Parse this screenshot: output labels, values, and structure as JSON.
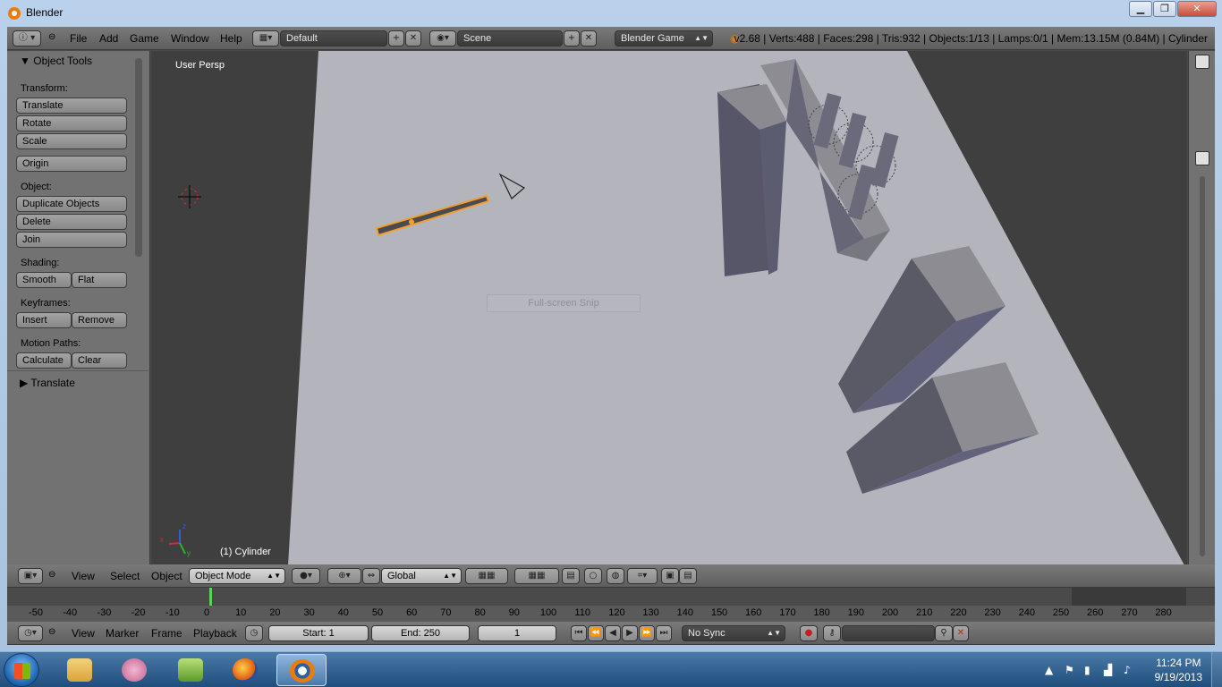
{
  "window": {
    "title": "Blender"
  },
  "top_header": {
    "menus": [
      "File",
      "Add",
      "Game",
      "Window",
      "Help"
    ],
    "screen_layout": "Default",
    "scene": "Scene",
    "engine": "Blender Game",
    "stats": "v2.68 | Verts:488 | Faces:298 | Tris:932 | Objects:1/13 | Lamps:0/1 | Mem:13.15M (0.84M) | Cylinder"
  },
  "tool_panel": {
    "title": "Object Tools",
    "transform_label": "Transform:",
    "translate": "Translate",
    "rotate": "Rotate",
    "scale": "Scale",
    "origin": "Origin",
    "object_label": "Object:",
    "duplicate": "Duplicate Objects",
    "delete": "Delete",
    "join": "Join",
    "shading_label": "Shading:",
    "smooth": "Smooth",
    "flat": "Flat",
    "keyframes_label": "Keyframes:",
    "insert": "Insert",
    "remove": "Remove",
    "motion_label": "Motion Paths:",
    "calculate": "Calculate",
    "clear": "Clear",
    "operator_panel": "Translate"
  },
  "viewport": {
    "view_label": "User Persp",
    "object_label": "(1) Cylinder",
    "snip_text": "Full-screen Snip",
    "axis_x": "x",
    "axis_y": "y",
    "axis_z": "z"
  },
  "view3d_header": {
    "menus": [
      "View",
      "Select",
      "Object"
    ],
    "mode": "Object Mode",
    "orientation": "Global"
  },
  "timeline": {
    "ticks": [
      "-50",
      "-40",
      "-30",
      "-20",
      "-10",
      "0",
      "10",
      "20",
      "30",
      "40",
      "50",
      "60",
      "70",
      "80",
      "90",
      "100",
      "110",
      "120",
      "130",
      "140",
      "150",
      "160",
      "170",
      "180",
      "190",
      "200",
      "210",
      "220",
      "230",
      "240",
      "250",
      "260",
      "270",
      "280"
    ],
    "current_frame_marker": 0
  },
  "timeline_header": {
    "menus": [
      "View",
      "Marker",
      "Frame",
      "Playback"
    ],
    "start": "Start: 1",
    "end": "End: 250",
    "frame": "1",
    "sync": "No Sync"
  },
  "taskbar": {
    "time": "11:24 PM",
    "date": "9/19/2013"
  },
  "colors": {
    "selection_outline": "#f0a030",
    "floor": "#b4b4bd",
    "background": "#3f3f3f"
  }
}
